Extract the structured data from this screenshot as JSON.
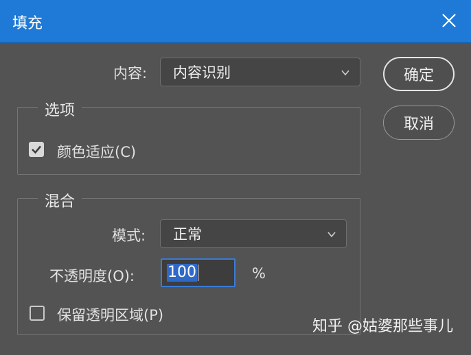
{
  "window": {
    "title": "填充"
  },
  "content": {
    "label": "内容:",
    "value": "内容识别"
  },
  "buttons": {
    "ok": "确定",
    "cancel": "取消"
  },
  "options": {
    "legend": "选项",
    "color_adapt": {
      "label": "颜色适应(C)",
      "checked": true
    }
  },
  "blend": {
    "legend": "混合",
    "mode_label": "模式:",
    "mode_value": "正常",
    "opacity_label": "不透明度(O):",
    "opacity_value": "100",
    "opacity_unit": "%",
    "preserve": {
      "label": "保留透明区域(P)",
      "checked": false
    }
  },
  "watermark": "知乎 @姑婆那些事儿",
  "colors": {
    "titlebar": "#1e7ad6",
    "background": "#535353",
    "selection": "#2f69c7"
  },
  "icons": {
    "close": "close-icon",
    "dropdown": "chevron-down-icon",
    "check": "checkmark-icon"
  }
}
